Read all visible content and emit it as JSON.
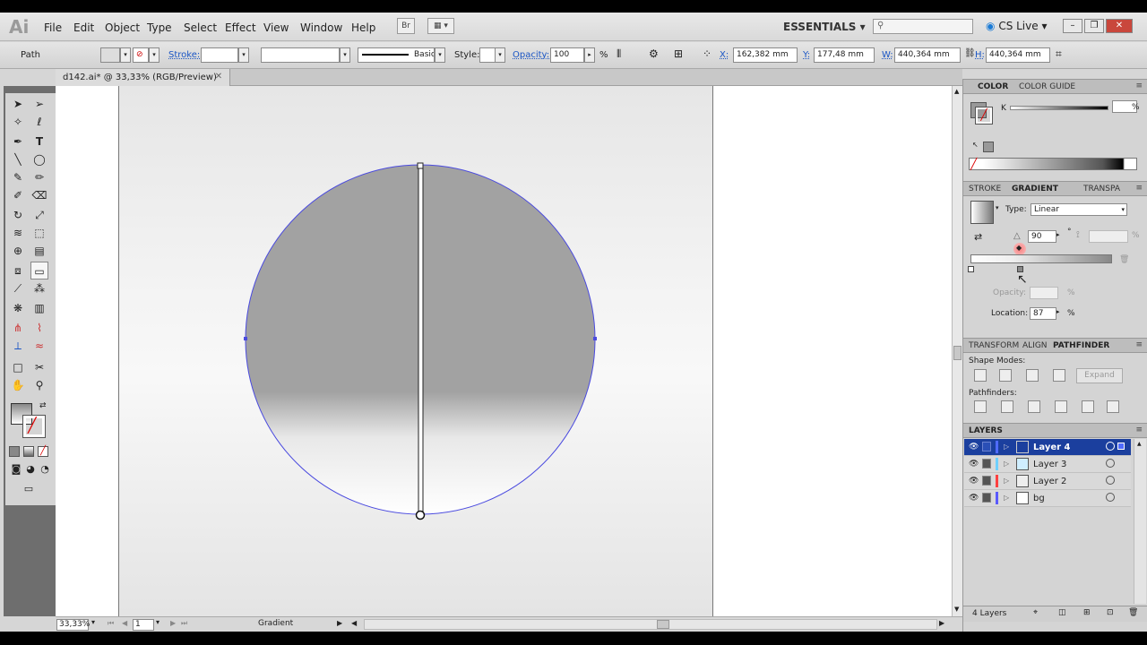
{
  "app": {
    "logo": "Ai",
    "menus": [
      "File",
      "Edit",
      "Object",
      "Type",
      "Select",
      "Effect",
      "View",
      "Window",
      "Help"
    ],
    "bridge_btn": "Br",
    "workspace": "ESSENTIALS",
    "cs_live": "CS Live",
    "search_placeholder": ""
  },
  "control_bar": {
    "selection_type": "Path",
    "stroke_label": "Stroke:",
    "stroke_profile": "Basic",
    "style_label": "Style:",
    "opacity_label": "Opacity:",
    "opacity_value": "100",
    "opacity_unit": "%",
    "x_label": "X:",
    "x_value": "162,382 mm",
    "y_label": "Y:",
    "y_value": "177,48 mm",
    "w_label": "W:",
    "w_value": "440,364 mm",
    "h_label": "H:",
    "h_value": "440,364 mm"
  },
  "document": {
    "tab_label": "d142.ai* @ 33,33% (RGB/Preview)"
  },
  "status": {
    "zoom": "33,33%",
    "artboard": "1",
    "tool": "Gradient"
  },
  "color_panel": {
    "tabs": [
      "COLOR",
      "COLOR GUIDE"
    ],
    "channel_label": "K",
    "channel_value": "",
    "channel_unit": "%"
  },
  "gradient_panel": {
    "tabs": [
      "STROKE",
      "GRADIENT",
      "TRANSPA"
    ],
    "type_label": "Type:",
    "type_value": "Linear",
    "angle_value": "90",
    "angle_unit": "°",
    "opacity_label": "Opacity:",
    "opacity_unit": "%",
    "location_label": "Location:",
    "location_value": "87",
    "location_unit": "%"
  },
  "pathfinder_panel": {
    "tabs": [
      "TRANSFORM",
      "ALIGN",
      "PATHFINDER"
    ],
    "shape_modes_label": "Shape Modes:",
    "expand_label": "Expand",
    "pathfinders_label": "Pathfinders:"
  },
  "layers_panel": {
    "title": "LAYERS",
    "layers": [
      {
        "name": "Layer 4",
        "color": "#4f6bff",
        "selected": true
      },
      {
        "name": "Layer 3",
        "color": "#6fd0ff",
        "selected": false
      },
      {
        "name": "Layer 2",
        "color": "#ff4040",
        "selected": false
      },
      {
        "name": "bg",
        "color": "#5a5aff",
        "selected": false
      }
    ],
    "count_label": "4 Layers"
  }
}
